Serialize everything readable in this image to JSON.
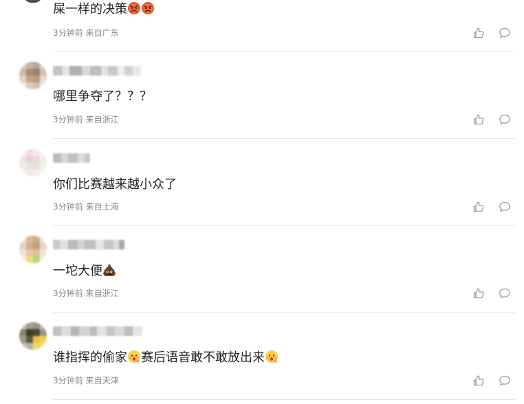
{
  "comments": [
    {
      "text": "屎一样的决策",
      "emojis": [
        "angry-face",
        "angry-face"
      ],
      "time": "3分钟前",
      "location": "来自广东"
    },
    {
      "text": "哪里争夺了？？？",
      "time": "3分钟前",
      "location": "来自浙江"
    },
    {
      "text": "你们比赛越来越小众了",
      "time": "3分钟前",
      "location": "来自上海"
    },
    {
      "text": "一坨大便",
      "emojis": [
        "poop"
      ],
      "time": "3分钟前",
      "location": "来自浙江"
    },
    {
      "text_part1": "谁指挥的偷家",
      "text_part2": "赛后语音敢不敢放出来",
      "emojis": [
        "surprised-face",
        "surprised-face"
      ],
      "time": "3分钟前",
      "location": "来自天津"
    }
  ],
  "icons": {
    "like": "thumbs-up-icon",
    "reply": "comment-bubble-icon"
  },
  "colors": {
    "text": "#222222",
    "meta": "#888888",
    "icon": "#999999",
    "divider": "#e8e8e8"
  }
}
